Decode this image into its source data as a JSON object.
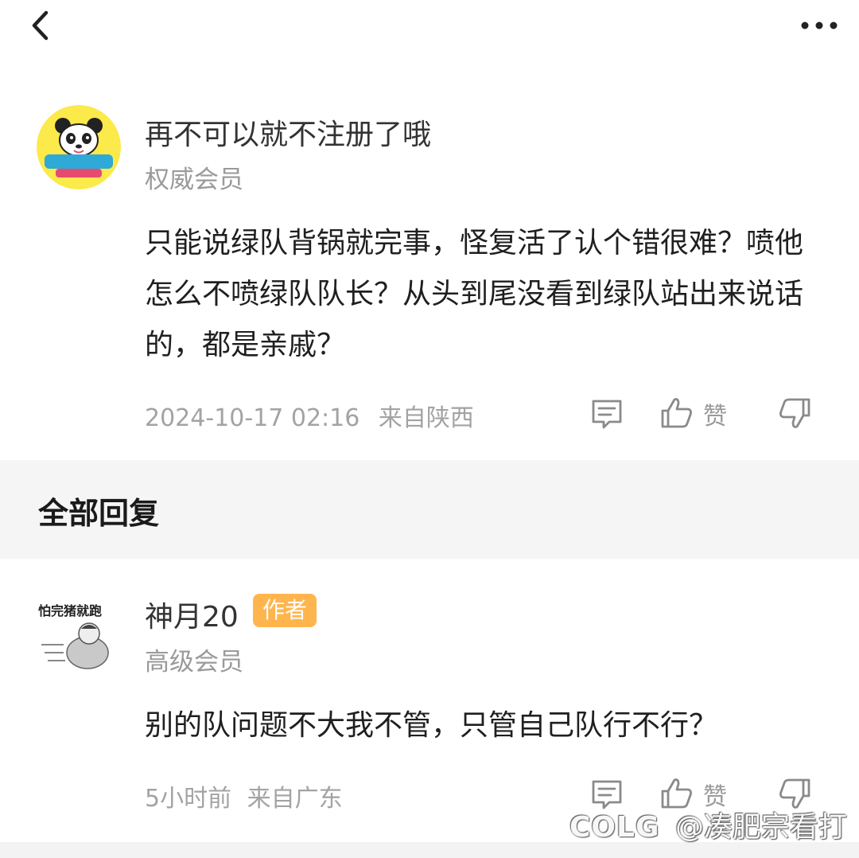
{
  "header": {
    "back_icon": "chevron-left-icon",
    "more_icon": "more-horizontal-icon"
  },
  "main_comment": {
    "username": "再不可以就不注册了哦",
    "level": "权威会员",
    "content": "只能说绿队背锅就完事，怪复活了认个错很难？喷他怎么不喷绿队队长？从头到尾没看到绿队站出来说话的，都是亲戚？",
    "timestamp": "2024-10-17 02:16",
    "location": "来自陕西",
    "like_label": "赞"
  },
  "replies_section": {
    "title": "全部回复"
  },
  "replies": [
    {
      "username": "神月20",
      "badge": "作者",
      "level": "高级会员",
      "content": "别的队问题不大我不管，只管自己队行不行？",
      "time": "5小时前",
      "location": "来自广东",
      "like_label": "赞",
      "avatar_caption": "怕完猪就跑"
    }
  ],
  "watermark": "@凑肥宗看打",
  "watermark_logo": "COLG",
  "colors": {
    "badge": "#ffb54d",
    "secondary_text": "#9a9a9a",
    "band": "#f5f5f5"
  }
}
